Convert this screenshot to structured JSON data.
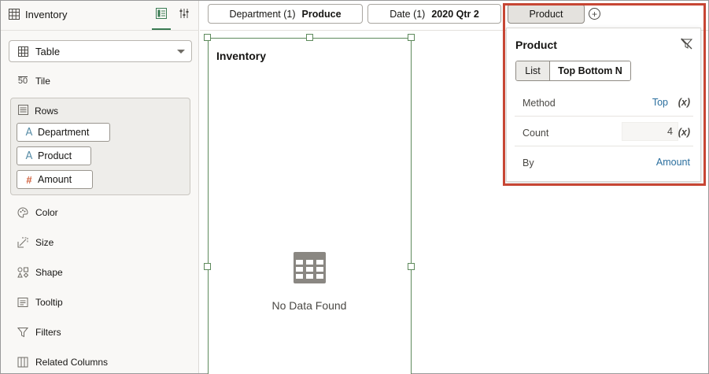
{
  "left_panel": {
    "data_source": "Inventory",
    "viz_type": "Table",
    "sections": {
      "tile": "Tile",
      "rows": "Rows",
      "color": "Color",
      "size": "Size",
      "shape": "Shape",
      "tooltip": "Tooltip",
      "filters": "Filters",
      "related_columns": "Related Columns"
    },
    "tile_icon_text": "50",
    "rows_items": [
      {
        "label": "Department",
        "kind": "attribute",
        "icon_text": "A"
      },
      {
        "label": "Product",
        "kind": "attribute",
        "icon_text": "A"
      },
      {
        "label": "Amount",
        "kind": "measure",
        "icon_text": "#"
      }
    ]
  },
  "filter_bar": {
    "chips": [
      {
        "name": "Department (1)",
        "value": "Produce"
      },
      {
        "name": "Date (1)",
        "value": "2020 Qtr 2"
      },
      {
        "name": "Product",
        "value": ""
      }
    ],
    "add_symbol": "+"
  },
  "canvas": {
    "viz_title": "Inventory",
    "empty_message": "No Data Found"
  },
  "filter_popup": {
    "title": "Product",
    "tabs": {
      "list": "List",
      "top_bottom": "Top Bottom N"
    },
    "method_label": "Method",
    "method_value": "Top",
    "count_label": "Count",
    "count_value": "4",
    "by_label": "By",
    "by_value": "Amount",
    "param_marker": "(x)"
  },
  "colors": {
    "accent_green": "#3a7b53",
    "link_blue": "#2a6e9e",
    "highlight_red": "#c74634",
    "measure_orange": "#d0603c",
    "attribute_blue": "#5b8fa8"
  }
}
